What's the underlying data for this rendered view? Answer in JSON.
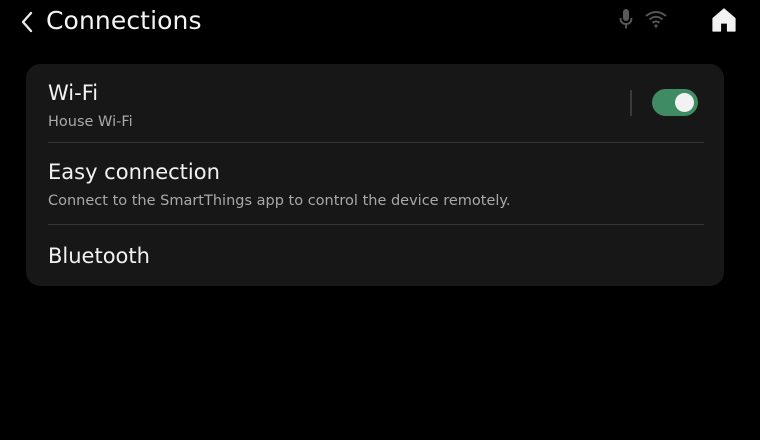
{
  "header": {
    "title": "Connections",
    "back_icon": "chevron-left-icon",
    "mic_icon": "microphone-icon",
    "wifi_icon": "wifi-signal-icon",
    "home_icon": "home-icon"
  },
  "settings": {
    "items": [
      {
        "title": "Wi-Fi",
        "subtitle": "House Wi-Fi",
        "toggle_on": true
      },
      {
        "title": "Easy connection",
        "subtitle": "Connect to the SmartThings app to control the device remotely."
      },
      {
        "title": "Bluetooth"
      }
    ]
  },
  "colors": {
    "background": "#000000",
    "card": "#171717",
    "toggle_on": "#3f8b63",
    "subtitle": "#a9a9a9"
  }
}
